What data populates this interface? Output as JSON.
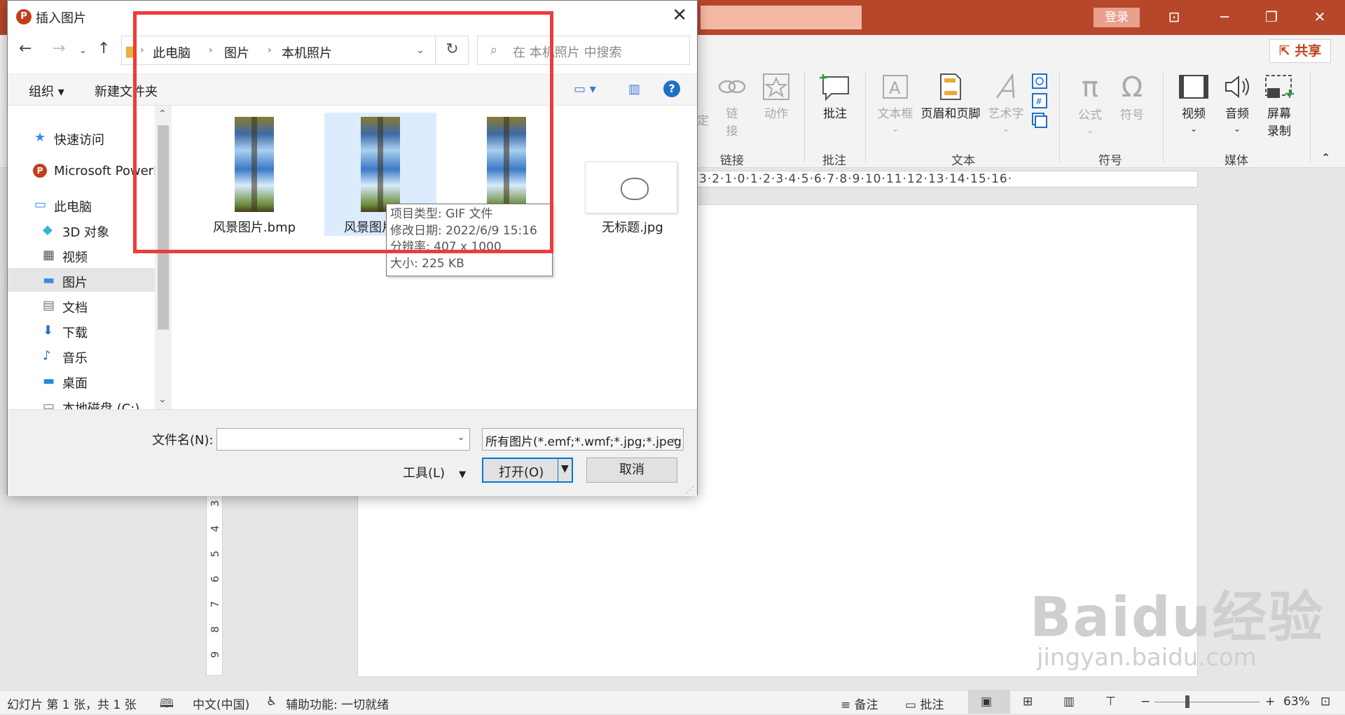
{
  "colors": {
    "ppt_brand": "#b7472a",
    "highlight_box": "#ee3b3b",
    "selection": "#dcecfc",
    "accent": "#0078d7"
  },
  "ppt": {
    "login_label": "登录",
    "share_label": "共享",
    "ribbon": {
      "partial_label": "定",
      "items": {
        "link": "链\n接",
        "action": "动作",
        "comment": "批注",
        "textbox": "文本框",
        "header_footer": "页眉和页脚",
        "wordart": "艺术字",
        "equation": "公式",
        "symbol": "符号",
        "video": "视频",
        "audio": "音频",
        "screen_recording": "屏幕\n录制"
      },
      "groups": {
        "links": "链接",
        "comments": "批注",
        "text": "文本",
        "symbols": "符号",
        "media": "媒体"
      }
    },
    "h_ruler_text": "3·2·1·0·1·2·3·4·5·6·7·8·9·10·11·12·13·14·15·16·",
    "v_ruler": [
      "3",
      "4",
      "5",
      "6",
      "7",
      "8",
      "9"
    ],
    "watermark": {
      "brand": "Baidu经验",
      "url": "jingyan.baidu.com"
    },
    "status": {
      "slide_count": "幻灯片 第 1 张，共 1 张",
      "language": "中文(中国)",
      "accessibility": "辅助功能: 一切就绪",
      "notes": "备注",
      "comments": "批注",
      "zoom": "63%"
    }
  },
  "dialog": {
    "title": "插入图片",
    "breadcrumb": [
      "此电脑",
      "图片",
      "本机照片"
    ],
    "search_placeholder": "在 本机照片 中搜索",
    "cmd": {
      "organize": "组织 ▾",
      "new_folder": "新建文件夹"
    },
    "nav": {
      "quick_access": "快速访问",
      "powerpoint": "Microsoft PowerI",
      "this_pc": "此电脑",
      "objects3d": "3D 对象",
      "videos": "视频",
      "pictures": "图片",
      "documents": "文档",
      "downloads": "下载",
      "music": "音乐",
      "desktop": "桌面",
      "local_disk": "本地磁盘 (C:)"
    },
    "files": [
      "风景图片.bmp",
      "风景图片",
      "",
      "无标题.jpg"
    ],
    "tooltip": {
      "type": "项目类型: GIF 文件",
      "modified": "修改日期: 2022/6/9 15:16",
      "resolution": "分辨率: 407 x 1000",
      "size": "大小: 225 KB"
    },
    "filename_label": "文件名(N):",
    "filename_value": "",
    "filetype_value": "所有图片(*.emf;*.wmf;*.jpg;*.jpeg",
    "tools_label": "工具(L)",
    "open_label": "打开(O)",
    "cancel_label": "取消"
  }
}
